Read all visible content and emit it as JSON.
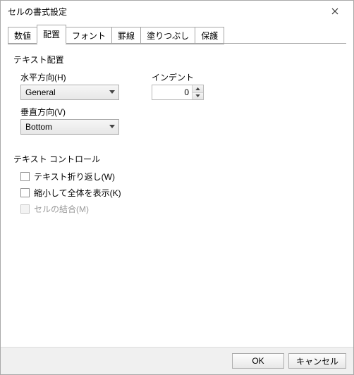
{
  "window": {
    "title": "セルの書式設定"
  },
  "tabs": {
    "items": [
      {
        "label": "数値"
      },
      {
        "label": "配置"
      },
      {
        "label": "フォント"
      },
      {
        "label": "罫線"
      },
      {
        "label": "塗りつぶし"
      },
      {
        "label": "保護"
      }
    ],
    "active_index": 1
  },
  "alignment": {
    "group_title": "テキスト配置",
    "horizontal": {
      "label": "水平方向(H)",
      "value": "General"
    },
    "vertical": {
      "label": "垂直方向(V)",
      "value": "Bottom"
    },
    "indent": {
      "label": "インデント",
      "value": "0"
    }
  },
  "text_control": {
    "group_title": "テキスト コントロール",
    "wrap": {
      "label": "テキスト折り返し(W)",
      "checked": false
    },
    "shrink": {
      "label": "縮小して全体を表示(K)",
      "checked": false
    },
    "merge": {
      "label": "セルの結合(M)",
      "checked": false,
      "disabled": true
    }
  },
  "footer": {
    "ok": "OK",
    "cancel": "キャンセル"
  }
}
